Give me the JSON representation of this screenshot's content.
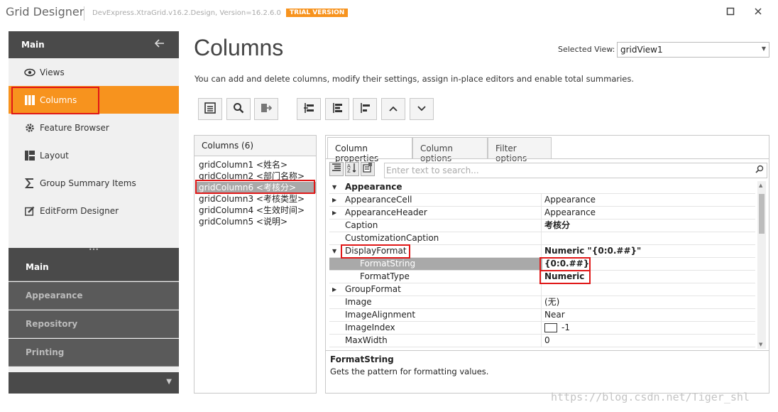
{
  "window": {
    "title": "Grid Designer",
    "version": "DevExpress.XtraGrid.v16.2.Design, Version=16.2.6.0",
    "trial_badge": "TRIAL VERSION",
    "maximize_icon": "maximize-icon",
    "close_icon": "close-icon"
  },
  "sidebar": {
    "header": "Main",
    "items": [
      {
        "label": "Views",
        "icon": "eye-icon"
      },
      {
        "label": "Columns",
        "icon": "columns-icon"
      },
      {
        "label": "Feature Browser",
        "icon": "gear-icon"
      },
      {
        "label": "Layout",
        "icon": "layout-icon"
      },
      {
        "label": "Group Summary Items",
        "icon": "sigma-icon"
      },
      {
        "label": "EditForm Designer",
        "icon": "edit-icon"
      }
    ],
    "groups": [
      "Main",
      "Appearance",
      "Repository",
      "Printing"
    ]
  },
  "main": {
    "title": "Columns",
    "selected_view_label": "Selected View:",
    "selected_view": "gridView1",
    "description": "You can add and delete columns, modify their settings, assign in-place editors and enable total summaries."
  },
  "columns_panel": {
    "header": "Columns (6)",
    "items": [
      "gridColumn1 <姓名>",
      "gridColumn2 <部门名称>",
      "gridColumn6 <考核分>",
      "gridColumn3 <考核类型>",
      "gridColumn4 <生效时间>",
      "gridColumn5 <说明>"
    ]
  },
  "properties": {
    "tabs": [
      "Column properties",
      "Column options",
      "Filter options"
    ],
    "search_placeholder": "Enter text to search...",
    "rows": [
      {
        "name": "Appearance",
        "value": ""
      },
      {
        "name": "AppearanceCell",
        "value": "Appearance"
      },
      {
        "name": "AppearanceHeader",
        "value": "Appearance"
      },
      {
        "name": "Caption",
        "value": "考核分"
      },
      {
        "name": "CustomizationCaption",
        "value": ""
      },
      {
        "name": "DisplayFormat",
        "value": "Numeric \"{0:0.##}\""
      },
      {
        "name": "FormatString",
        "value": "{0:0.##}"
      },
      {
        "name": "FormatType",
        "value": "Numeric"
      },
      {
        "name": "GroupFormat",
        "value": ""
      },
      {
        "name": "Image",
        "value": "(无)"
      },
      {
        "name": "ImageAlignment",
        "value": "Near"
      },
      {
        "name": "ImageIndex",
        "value": "-1"
      },
      {
        "name": "MaxWidth",
        "value": "0"
      }
    ],
    "description_title": "FormatString",
    "description_text": "Gets the pattern for formatting values."
  },
  "watermark": "https://blog.csdn.net/Tiger_shl"
}
